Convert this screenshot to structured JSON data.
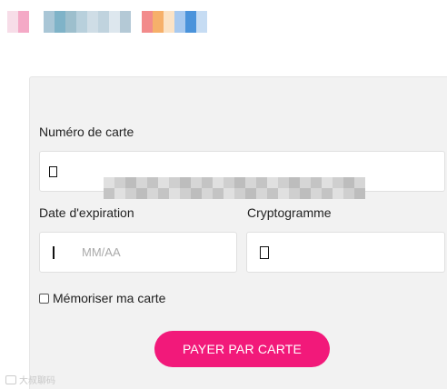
{
  "header": {
    "logo_a_colors": [
      "#f7dde8",
      "#f4a9c6"
    ],
    "logo_b_colors": [
      "#a9c6d6",
      "#7fb3c8",
      "#9dbfcd",
      "#b8d0dc",
      "#cfdde6",
      "#c0d3de",
      "#dde7ee",
      "#b4c9d6"
    ],
    "logo_c_colors": [
      "#f28b8b",
      "#f6b06a",
      "#fbe3c6",
      "#a7c9ef",
      "#4a93db",
      "#c6dcf3"
    ]
  },
  "form": {
    "card_number_label": "Numéro de carte",
    "card_number_value": "",
    "expiry_label": "Date d'expiration",
    "expiry_placeholder": "MM/AA",
    "cvc_label": "Cryptogramme",
    "cvc_value": "",
    "remember_label": "Mémoriser ma carte",
    "remember_checked": false,
    "pay_button_label": "PAYER PAR CARTE"
  },
  "icons": {
    "card_number_icon": "glyph-placeholder-icon",
    "expiry_icon": "glyph-placeholder-icon",
    "cvc_icon": "glyph-placeholder-icon"
  },
  "colors": {
    "accent": "#f2197a",
    "panel_bg": "#f2f2f2",
    "blur_tones": [
      "#e0e0e0",
      "#cfcfcf",
      "#bdbdbd",
      "#d6d6d6",
      "#c4c4c4",
      "#e8e8e8"
    ]
  },
  "watermark": {
    "text": "大叔聊码"
  }
}
